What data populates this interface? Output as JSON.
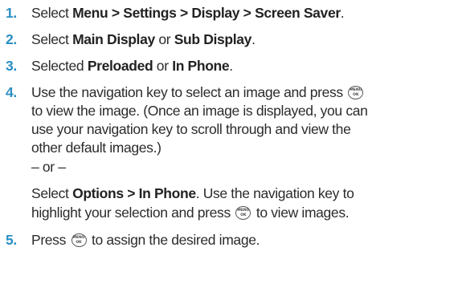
{
  "steps": [
    {
      "number": "1.",
      "pre": "Select ",
      "bold": "Menu > Settings > Display > Screen Saver",
      "post": "."
    },
    {
      "number": "2.",
      "pre": "Select ",
      "bold1": "Main Display",
      "mid": " or ",
      "bold2": "Sub Display",
      "post": "."
    },
    {
      "number": "3.",
      "pre": "Selected ",
      "bold1": "Preloaded",
      "mid": " or ",
      "bold2": "In Phone",
      "post": "."
    },
    {
      "number": "4.",
      "line1_text": "Use the navigation key to select an image and press",
      "line2_text": "to view the image. (Once an image is displayed, you can",
      "line3_text": "use your navigation key to scroll through and view the",
      "line4_text": "other default images.)",
      "or_text": "– or –",
      "alt_pre": "Select ",
      "alt_bold": "Options > In Phone",
      "alt_post": ". Use the navigation key to",
      "alt_line2_pre": "highlight your selection and press",
      "alt_line2_post": "to view images."
    },
    {
      "number": "5.",
      "pre": "Press",
      "post": "to assign the desired image."
    }
  ],
  "key_icon": {
    "name": "menu-ok-key-icon",
    "label_top": "MENU",
    "label_bottom": "OK"
  },
  "colors": {
    "step_number": "#2a8fc4",
    "text": "#2b2b2b"
  }
}
